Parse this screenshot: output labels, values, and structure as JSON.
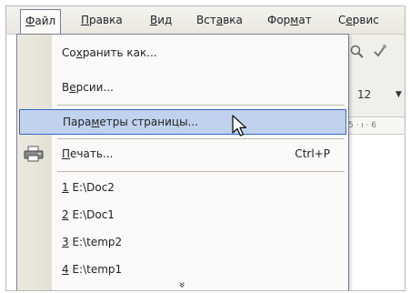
{
  "menubar": {
    "items": [
      {
        "prefix": "",
        "key": "Ф",
        "suffix": "айл"
      },
      {
        "prefix": "",
        "key": "П",
        "suffix": "равка"
      },
      {
        "prefix": "",
        "key": "В",
        "suffix": "ид"
      },
      {
        "prefix": "Вст",
        "key": "а",
        "suffix": "вка"
      },
      {
        "prefix": "Фор",
        "key": "м",
        "suffix": "ат"
      },
      {
        "prefix": "С",
        "key": "е",
        "suffix": "рвис"
      }
    ]
  },
  "toolbar": {
    "font_size": "12",
    "ruler_text": "5 · ı · 6"
  },
  "file_menu": {
    "items": [
      {
        "prefix": "Со",
        "key": "х",
        "suffix": "ранить как...",
        "shortcut": ""
      },
      {
        "prefix": "В",
        "key": "е",
        "suffix": "рсии...",
        "shortcut": ""
      },
      {
        "prefix": "Пара",
        "key": "м",
        "suffix": "етры страницы...",
        "shortcut": "",
        "highlighted": true
      },
      {
        "prefix": "",
        "key": "П",
        "suffix": "ечать...",
        "shortcut": "Ctrl+P",
        "icon": "printer-icon"
      },
      {
        "prefix": "",
        "key": "1",
        "suffix": " E:\\Doc2",
        "shortcut": ""
      },
      {
        "prefix": "",
        "key": "2",
        "suffix": " E:\\Doc1",
        "shortcut": ""
      },
      {
        "prefix": "",
        "key": "3",
        "suffix": " E:\\temp2",
        "shortcut": ""
      },
      {
        "prefix": "",
        "key": "4",
        "suffix": " E:\\temp1",
        "shortcut": ""
      }
    ],
    "expand_glyph": "»"
  },
  "icons": [
    "printer-icon",
    "preview-icon",
    "spelling-icon",
    "expand-menu-chevron-icon",
    "mouse-cursor-icon"
  ],
  "colors": {
    "highlight_fill": "#c1d2ee",
    "highlight_border": "#316ac5",
    "menu_gutter": "#e3e0d5"
  }
}
